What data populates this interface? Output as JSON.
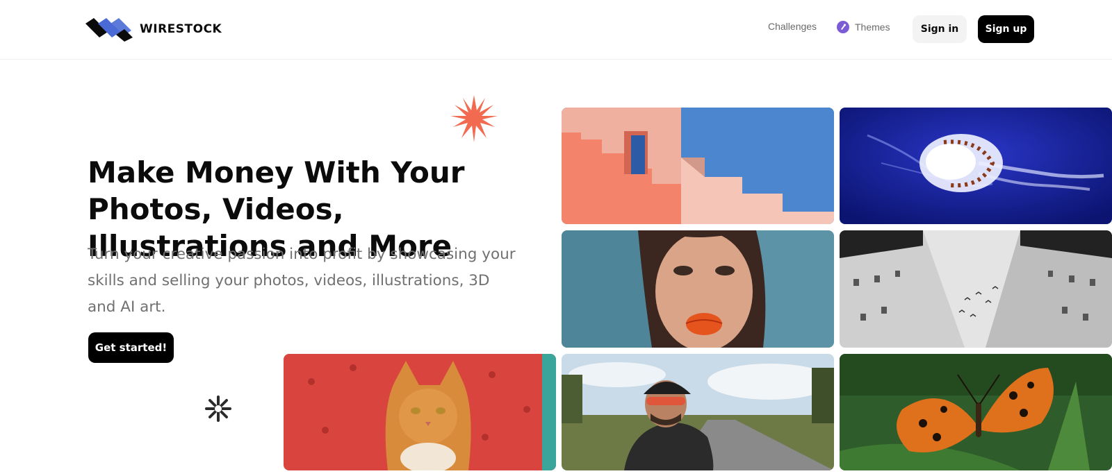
{
  "brand": {
    "name": "WIRESTOCK"
  },
  "nav": {
    "challenges": "Challenges",
    "themes": "Themes",
    "sign_in": "Sign in",
    "sign_up": "Sign up"
  },
  "hero": {
    "title": "Make Money With Your Photos, Videos, Illustrations and More",
    "subtitle": "Turn your creative passion into profit by showcasing your skills and selling your photos, videos, illustrations, 3D and AI art.",
    "cta": "Get started!"
  },
  "icons": {
    "logo": "wirestock-logo-icon",
    "themes": "themes-badge-icon",
    "starburst": "starburst-decoration-icon",
    "asterisk": "asterisk-decoration-icon"
  },
  "colors": {
    "primary_button": "#000000",
    "secondary_button": "#f3f3f3",
    "starburst": "#f26a4f",
    "logo_blue": "#4a6bd6",
    "themes_purple": "#7b5cd6"
  },
  "gallery": [
    {
      "subject": "pink stairs against blue sky"
    },
    {
      "subject": "jellyfish in deep blue water"
    },
    {
      "subject": "portrait of woman with orange lips"
    },
    {
      "subject": "black and white buildings with birds"
    },
    {
      "subject": "orange cat on red leather chair"
    },
    {
      "subject": "cyclist on country road"
    },
    {
      "subject": "orange butterfly on green leaf"
    }
  ]
}
